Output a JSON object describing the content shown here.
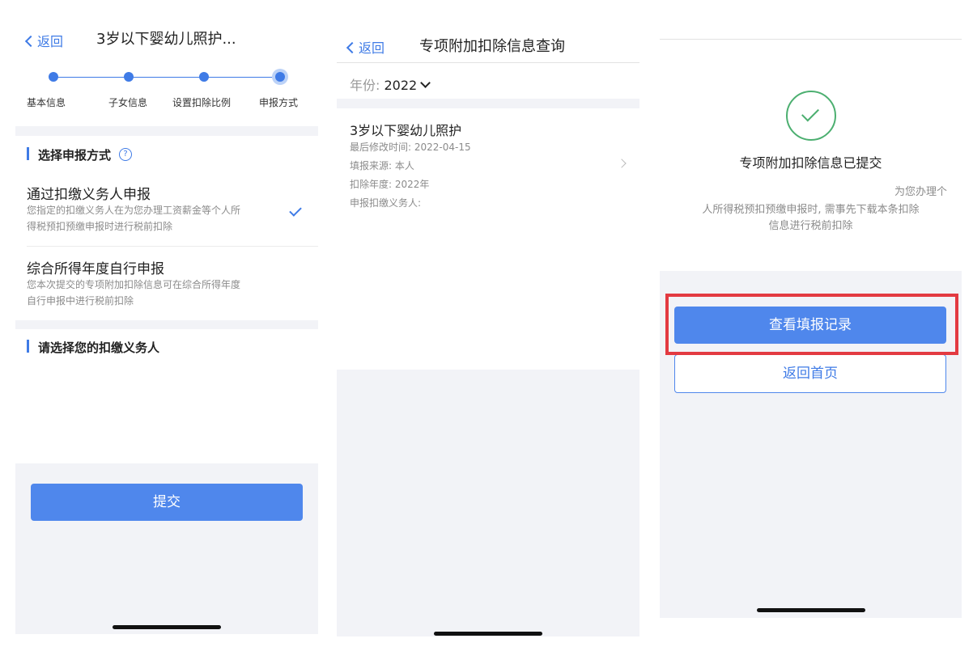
{
  "screen1": {
    "back": "返回",
    "title": "3岁以下婴幼儿照护...",
    "steps": [
      "基本信息",
      "子女信息",
      "设置扣除比例",
      "申报方式"
    ],
    "section1": "选择申报方式",
    "options": [
      {
        "title": "通过扣缴义务人申报",
        "desc1": "您指定的扣缴义务人在为您办理工资薪金等个人所",
        "desc2": "得税预扣预缴申报时进行税前扣除"
      },
      {
        "title": "综合所得年度自行申报",
        "desc1": "您本次提交的专项附加扣除信息可在综合所得年度",
        "desc2": "自行申报中进行税前扣除"
      }
    ],
    "section2": "请选择您的扣缴义务人",
    "submit": "提交"
  },
  "screen2": {
    "back": "返回",
    "title": "专项附加扣除信息查询",
    "year_label": "年份:",
    "year_value": "2022",
    "record": {
      "title": "3岁以下婴幼儿照护",
      "modified": "最后修改时间: 2022-04-15",
      "source": "填报来源: 本人",
      "year": "扣除年度: 2022年",
      "agent": "申报扣缴义务人:"
    }
  },
  "screen3": {
    "title": "专项附加扣除信息已提交",
    "desc1": "为您办理个",
    "desc2": "人所得税预扣预缴申报时, 需事先下载本条扣除",
    "desc3": "信息进行税前扣除",
    "view_records": "查看填报记录",
    "back_home": "返回首页"
  },
  "colors": {
    "accent": "#3f7be6",
    "button": "#4f87ec",
    "success": "#4caf70",
    "highlight": "#e33a41"
  }
}
